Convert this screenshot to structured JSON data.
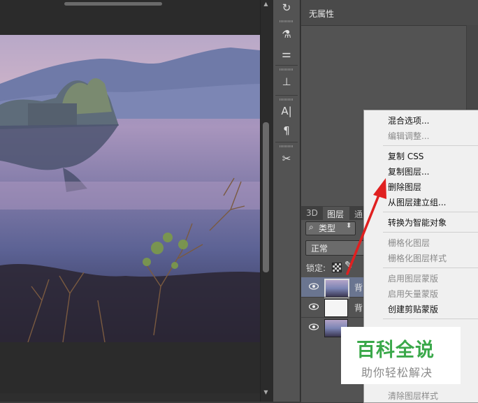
{
  "properties_panel": {
    "title": "无属性"
  },
  "layers_panel": {
    "tabs": [
      "3D",
      "图层",
      "通"
    ],
    "filter_label": "类型",
    "filter_icon": "search-icon",
    "blend_mode": "正常",
    "lock_label": "锁定:",
    "layers": [
      {
        "name": "背",
        "selected": true
      },
      {
        "name": "背",
        "selected": false
      },
      {
        "name": "",
        "selected": false
      }
    ]
  },
  "context_menu": {
    "items": [
      {
        "label": "混合选项...",
        "enabled": true
      },
      {
        "label": "编辑调整...",
        "enabled": false
      },
      {
        "label": "复制 CSS",
        "enabled": true
      },
      {
        "label": "复制图层...",
        "enabled": true
      },
      {
        "label": "删除图层",
        "enabled": true
      },
      {
        "label": "从图层建立组...",
        "enabled": true
      },
      {
        "label": "转换为智能对象",
        "enabled": true
      },
      {
        "label": "栅格化图层",
        "enabled": false
      },
      {
        "label": "栅格化图层样式",
        "enabled": false
      },
      {
        "label": "启用图层蒙版",
        "enabled": false
      },
      {
        "label": "启用矢量蒙版",
        "enabled": false
      },
      {
        "label": "创建剪贴蒙版",
        "enabled": true
      },
      {
        "label": "清除图层样式",
        "enabled": false
      }
    ]
  },
  "tools": [
    "history-icon",
    "brush-presets-icon",
    "tool-presets-icon",
    "stamp-icon",
    "character-icon",
    "paragraph-icon",
    "tools-icon"
  ],
  "watermark": {
    "title": "百科全说",
    "subtitle": "助你轻松解决"
  },
  "colors": {
    "accent_green": "#3aa84a",
    "arrow_red": "#e02020",
    "panel_bg": "#535353"
  }
}
